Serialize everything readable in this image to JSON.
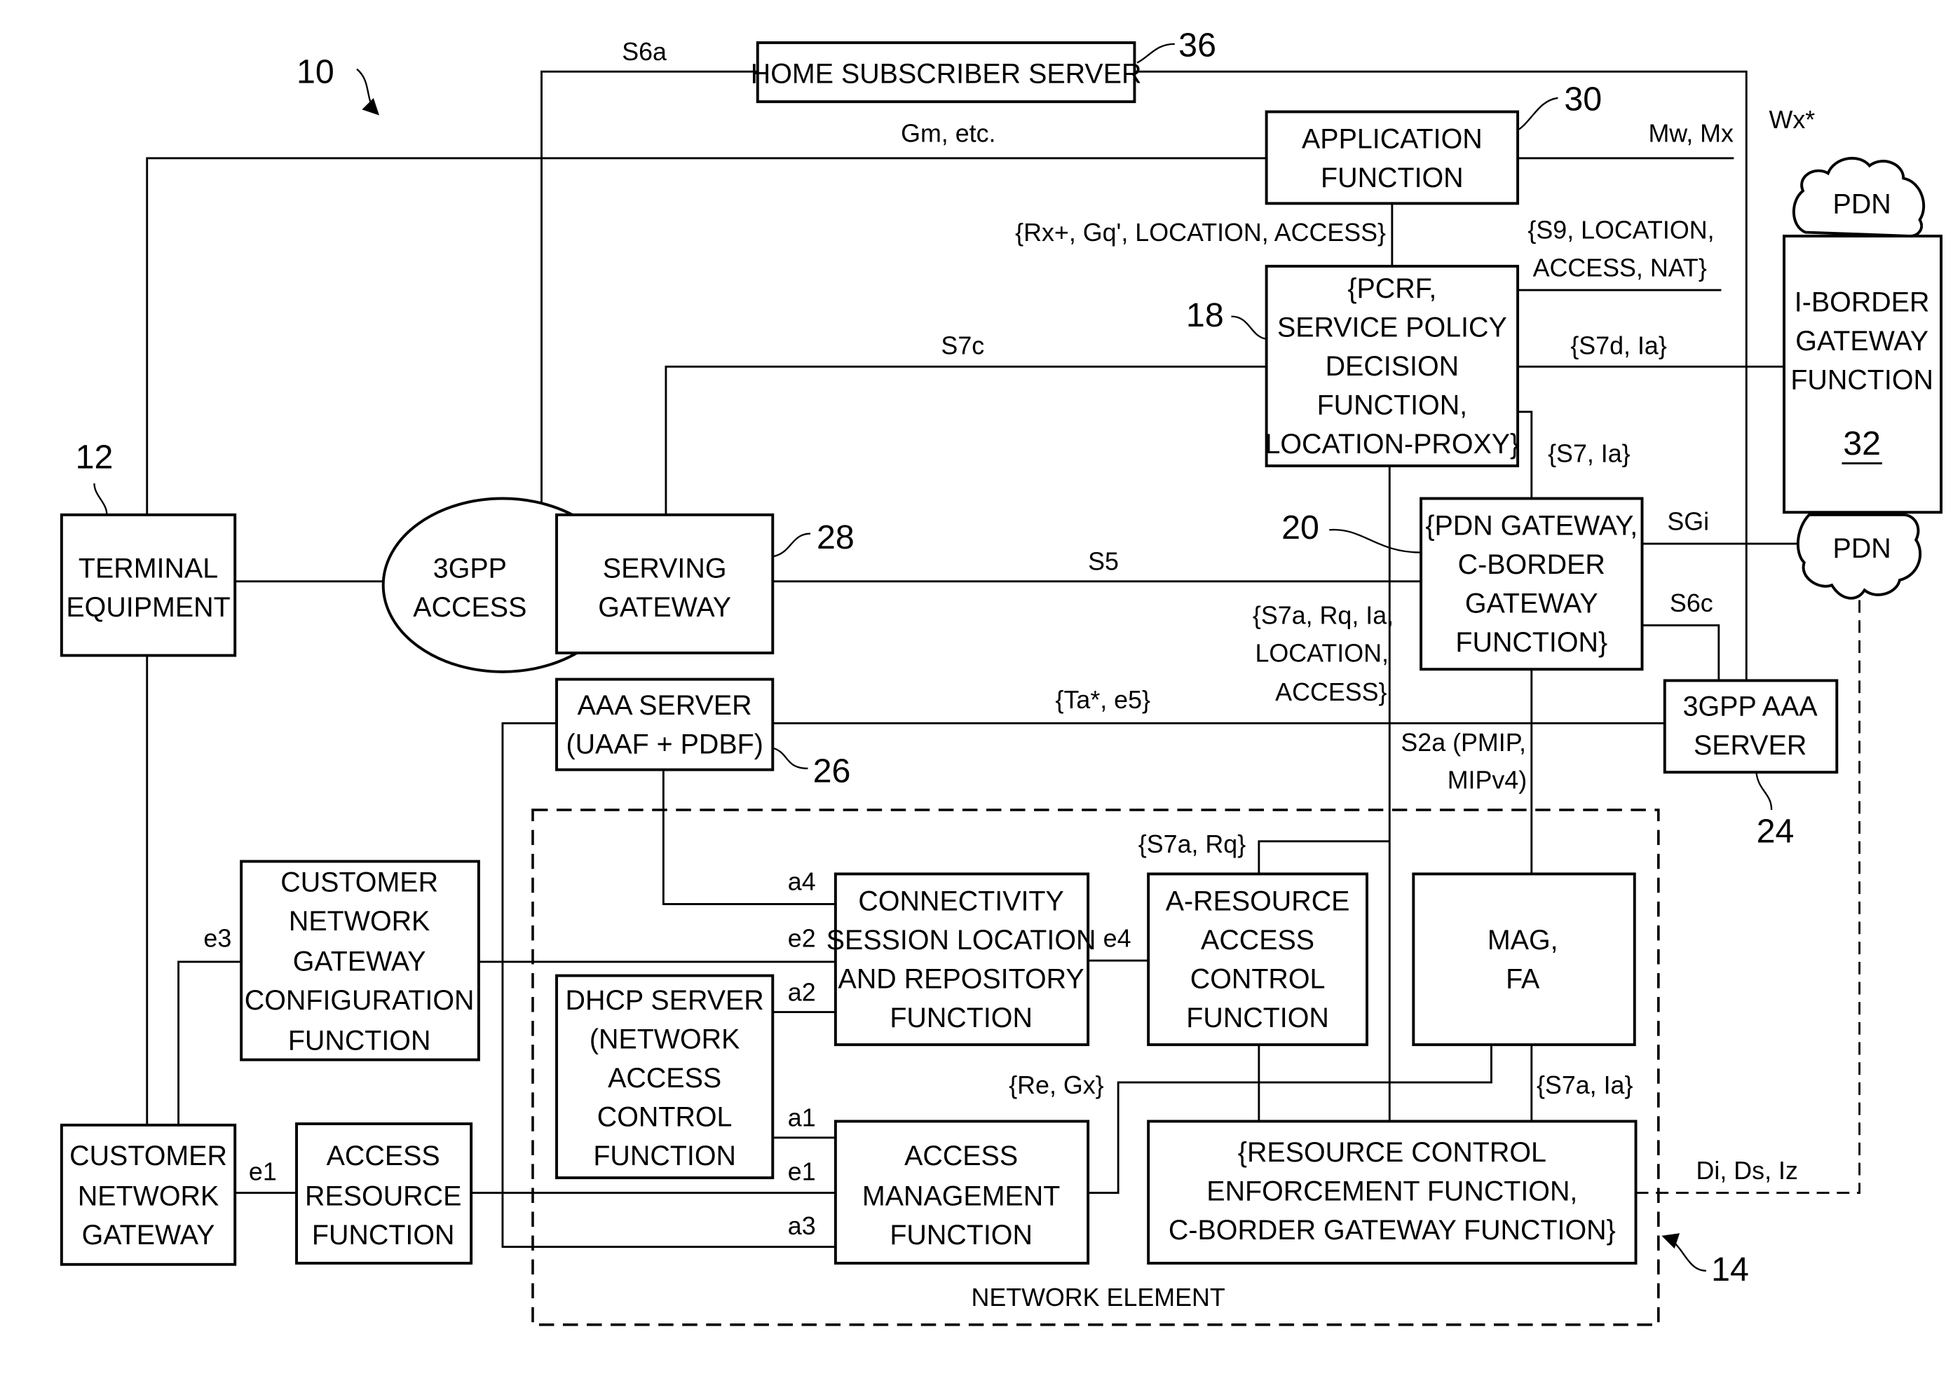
{
  "figure": {
    "ref_system": "10",
    "ref_network_element": "14"
  },
  "boxes": {
    "hss": {
      "lines": [
        "HOME SUBSCRIBER SERVER"
      ],
      "ref": "36"
    },
    "af": {
      "lines": [
        "APPLICATION",
        "FUNCTION"
      ],
      "ref": "30"
    },
    "pcrf": {
      "lines": [
        "{PCRF,",
        "SERVICE POLICY",
        "DECISION",
        "FUNCTION,",
        "LOCATION-PROXY}"
      ],
      "ref": "18"
    },
    "iborder": {
      "lines": [
        "I-BORDER",
        "GATEWAY",
        "FUNCTION"
      ],
      "ref": "32"
    },
    "terminal": {
      "lines": [
        "TERMINAL",
        "EQUIPMENT"
      ],
      "ref": "12"
    },
    "access3gpp": {
      "lines": [
        "3GPP",
        "ACCESS"
      ]
    },
    "sgw": {
      "lines": [
        "SERVING",
        "GATEWAY"
      ],
      "ref": "28"
    },
    "pgw": {
      "lines": [
        "{PDN GATEWAY,",
        "C-BORDER",
        "GATEWAY",
        "FUNCTION}"
      ],
      "ref": "20"
    },
    "aaa": {
      "lines": [
        "AAA SERVER",
        "(UAAF + PDBF)"
      ],
      "ref": "26"
    },
    "aaa3gpp": {
      "lines": [
        "3GPP AAA",
        "SERVER"
      ],
      "ref": "24"
    },
    "cngcf": {
      "lines": [
        "CUSTOMER",
        "NETWORK",
        "GATEWAY",
        "CONFIGURATION",
        "FUNCTION"
      ]
    },
    "clf": {
      "lines": [
        "CONNECTIVITY",
        "SESSION LOCATION",
        "AND REPOSITORY",
        "FUNCTION"
      ]
    },
    "aracf": {
      "lines": [
        "A-RESOURCE",
        "ACCESS",
        "CONTROL",
        "FUNCTION"
      ]
    },
    "mag": {
      "lines": [
        "MAG,",
        "FA"
      ]
    },
    "dhcp": {
      "lines": [
        "DHCP SERVER",
        "(NETWORK",
        "ACCESS",
        "CONTROL",
        "FUNCTION"
      ]
    },
    "cng": {
      "lines": [
        "CUSTOMER",
        "NETWORK",
        "GATEWAY"
      ]
    },
    "arf": {
      "lines": [
        "ACCESS",
        "RESOURCE",
        "FUNCTION"
      ]
    },
    "amf": {
      "lines": [
        "ACCESS",
        "MANAGEMENT",
        "FUNCTION"
      ]
    },
    "rcef": {
      "lines": [
        "{RESOURCE CONTROL",
        "ENFORCEMENT FUNCTION,",
        "C-BORDER GATEWAY FUNCTION}"
      ]
    },
    "pdn_top": {
      "lines": [
        "PDN"
      ]
    },
    "pdn_mid": {
      "lines": [
        "PDN"
      ]
    }
  },
  "network_element_label": "NETWORK ELEMENT",
  "interfaces": {
    "s6a": "S6a",
    "gm": "Gm, etc.",
    "mw_mx": "Mw, Mx",
    "wx": "Wx*",
    "rx": "{Rx+, Gq', LOCATION, ACCESS}",
    "s9_1": "{S9, LOCATION,",
    "s9_2": "ACCESS, NAT}",
    "s7c": "S7c",
    "s7d": "{S7d, Ia}",
    "s7": "{S7, Ia}",
    "s5": "S5",
    "sgi": "SGi",
    "s6c": "S6c",
    "s7a_1": "{S7a, Rq, Ia,",
    "s7a_2": "LOCATION,",
    "s7a_3": "ACCESS}",
    "ta": "{Ta*, e5}",
    "s2a_1": "S2a (PMIP,",
    "s2a_2": "MIPv4)",
    "s7a_rq": "{S7a, Rq}",
    "a4": "a4",
    "e2": "e2",
    "e4": "e4",
    "a2": "a2",
    "a1": "a1",
    "e1_inner": "e1",
    "a3": "a3",
    "e3": "e3",
    "e1_outer": "e1",
    "re_gx": "{Re, Gx}",
    "s7a_ia": "{S7a, Ia}",
    "di_ds_iz": "Di, Ds, Iz"
  }
}
